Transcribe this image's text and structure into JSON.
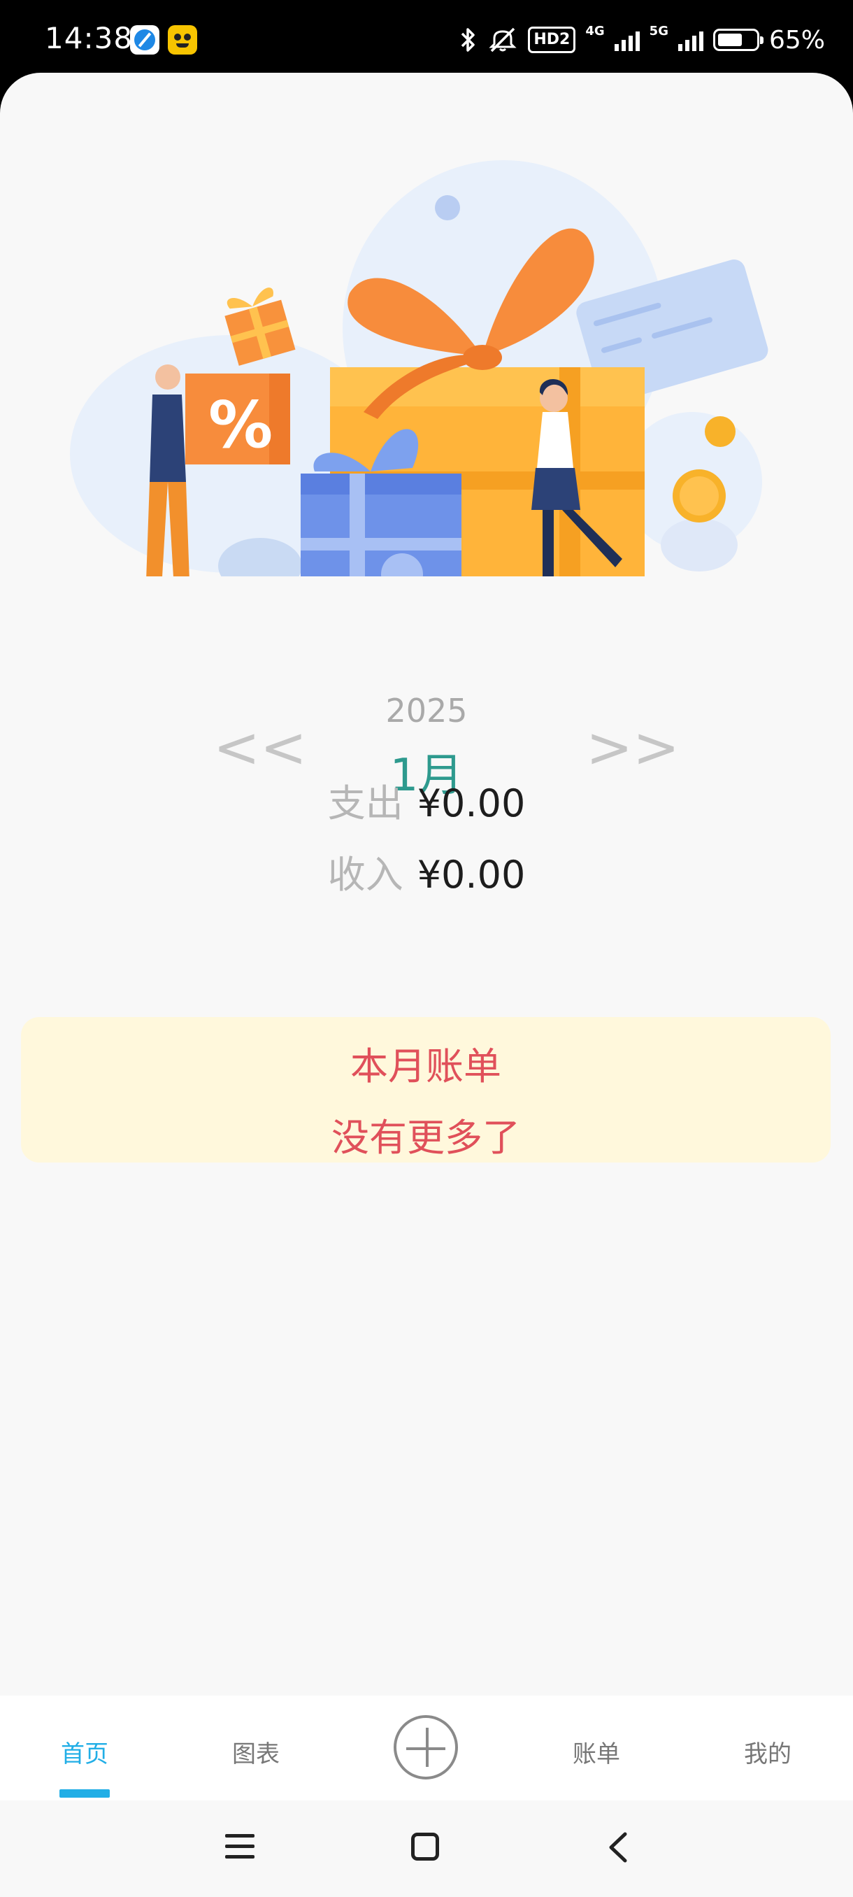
{
  "status_bar": {
    "time": "14:38",
    "hd_label": "HD2",
    "net_4g": "4G",
    "net_5g": "5G",
    "battery_text": "65%",
    "battery_level": 0.65,
    "icons": [
      "browser-app-icon",
      "game-app-icon",
      "bluetooth-icon",
      "mute-vibrate-icon",
      "signal-icon",
      "battery-icon"
    ]
  },
  "nav": {
    "year": "2025",
    "month": "1月",
    "prev_label": "<<",
    "next_label": ">>"
  },
  "summary": {
    "expense_label": "支出",
    "expense_value": "¥0.00",
    "income_label": "收入",
    "income_value": "¥0.00"
  },
  "bill_card": {
    "title": "本月账单",
    "empty_text": "没有更多了"
  },
  "tabs": [
    {
      "label": "首页",
      "active": true
    },
    {
      "label": "图表",
      "active": false
    },
    {
      "label": "账单",
      "active": false
    },
    {
      "label": "我的",
      "active": false
    }
  ],
  "colors": {
    "accent": "#21aee6",
    "month": "#2e9a8e",
    "bill_text": "#e0505a",
    "bill_bg": "#fff8dc"
  }
}
